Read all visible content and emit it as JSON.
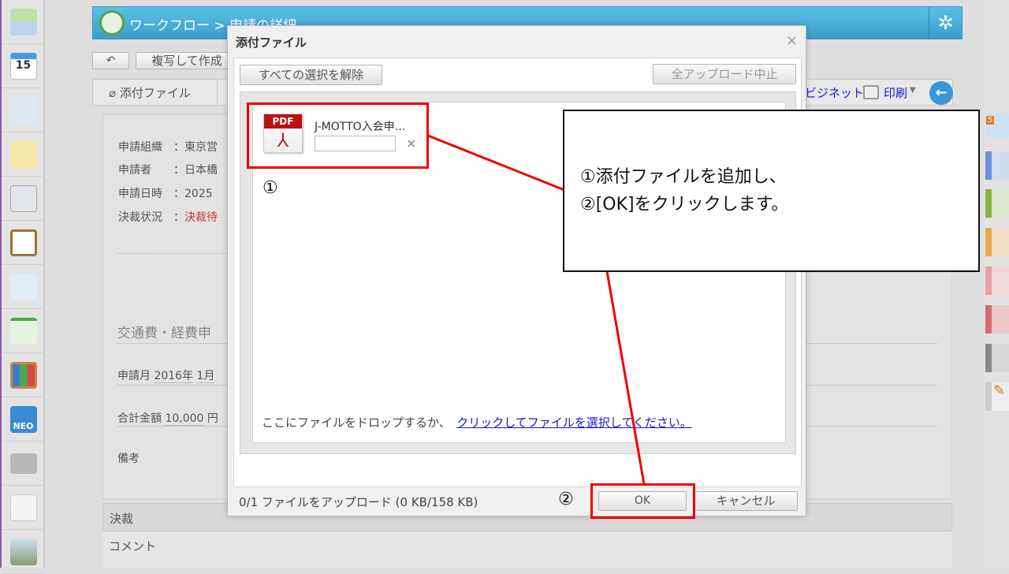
{
  "header": {
    "title": "ワークフロー > 申請の詳細",
    "gear_icon": "gear-icon"
  },
  "toolbar": {
    "back_icon": "back-arrow-icon",
    "copy_label": "複写して作成"
  },
  "tabs": {
    "attach_label": "添付ファイル",
    "cabinet_label": "ビジネット",
    "print_label": "印刷"
  },
  "fields": [
    {
      "label": "申請組織",
      "value": "東京営"
    },
    {
      "label": "申請者",
      "value": "日本橋"
    },
    {
      "label": "申請日時",
      "value": "2025"
    },
    {
      "label": "決裁状況",
      "value": "決裁待"
    }
  ],
  "form": {
    "title": "交通費・経費申",
    "month_label": "申請月",
    "year": "2016年",
    "month": "1月",
    "total_label": "合計金額",
    "total": "10,000",
    "total_unit": "円",
    "note_label": "備考"
  },
  "approval": {
    "title": "決裁",
    "comment_label": "コメント"
  },
  "modal": {
    "title": "添付ファイル",
    "deselect_all": "すべての選択を解除",
    "stop_all": "全アップロード中止",
    "file": {
      "type": "PDF",
      "name": "J-MOTTO入会申…",
      "comment": ""
    },
    "drop_text": "ここにファイルをドロップするか、",
    "select_link": "クリックしてファイルを選択してください。",
    "status": "0/1 ファイルをアップロード (0 KB/158 KB)",
    "ok": "OK",
    "cancel": "キャンセル"
  },
  "annotation": {
    "marker1": "①",
    "marker2": "②",
    "line1": "①添付ファイルを追加し、",
    "line2": "②[OK]をクリックします。",
    "color": "#e00000"
  },
  "right_tabs": {
    "badge": "5",
    "colors": [
      "#6a8fd8",
      "#8ab04a",
      "#e8a850",
      "#e8a0a8",
      "#d86a6a",
      "#888888"
    ]
  }
}
